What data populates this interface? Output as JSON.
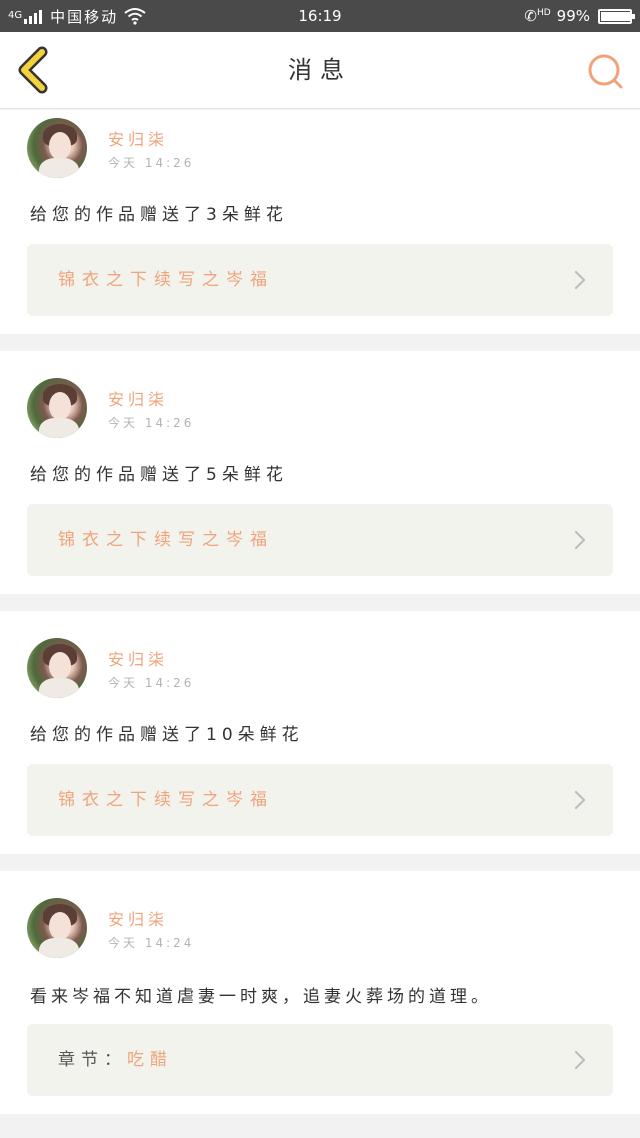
{
  "status_bar": {
    "network": "4G",
    "carrier": "中国移动",
    "time": "16:19",
    "hd": "HD",
    "battery_percent": "99%",
    "battery_level": 0.99
  },
  "nav": {
    "back_icon": "chevron-left-icon",
    "title": "消息",
    "search_icon": "search-icon",
    "accent_color": "#f0a37b",
    "back_color": "#f5d23c"
  },
  "messages": [
    {
      "username": "安归柒",
      "time": "今天 14:26",
      "text": "给您的作品赠送了3朵鲜花",
      "link_text": "锦衣之下续写之岑福"
    },
    {
      "username": "安归柒",
      "time": "今天 14:26",
      "text": "给您的作品赠送了5朵鲜花",
      "link_text": "锦衣之下续写之岑福"
    },
    {
      "username": "安归柒",
      "time": "今天 14:26",
      "text": "给您的作品赠送了10朵鲜花",
      "link_text": "锦衣之下续写之岑福"
    },
    {
      "username": "安归柒",
      "time": "今天 14:24",
      "text": "看来岑福不知道虐妻一时爽，追妻火葬场的道理。",
      "link_prefix": "章节：",
      "link_text": "吃醋"
    }
  ]
}
